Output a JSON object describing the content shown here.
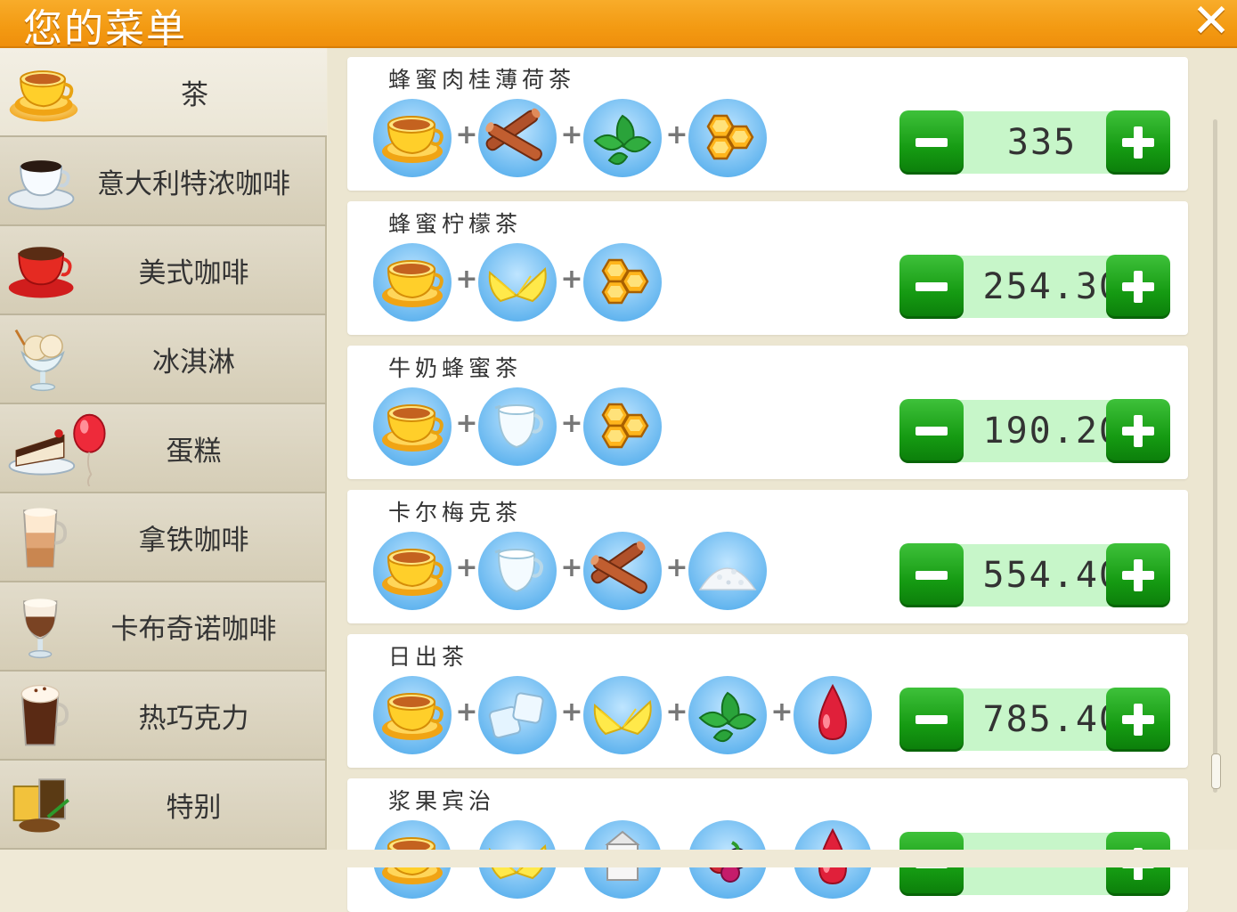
{
  "header": {
    "title": "您的菜单",
    "close_label": "✕"
  },
  "categories": [
    {
      "label": "茶",
      "icon": "tea-cup-icon",
      "active": true
    },
    {
      "label": "意大利特浓咖啡",
      "icon": "espresso-cup-icon"
    },
    {
      "label": "美式咖啡",
      "icon": "americano-cup-icon"
    },
    {
      "label": "冰淇淋",
      "icon": "ice-cream-icon"
    },
    {
      "label": "蛋糕",
      "icon": "cake-with-balloon-icon"
    },
    {
      "label": "拿铁咖啡",
      "icon": "latte-glass-icon"
    },
    {
      "label": "卡布奇诺咖啡",
      "icon": "cappuccino-glass-icon"
    },
    {
      "label": "热巧克力",
      "icon": "hot-chocolate-icon"
    },
    {
      "label": "特别",
      "icon": "special-drinks-icon"
    }
  ],
  "recipes": [
    {
      "name": "蜂蜜肉桂薄荷茶",
      "ingredients": [
        "tea",
        "cinnamon",
        "mint",
        "honey"
      ],
      "price": "335"
    },
    {
      "name": "蜂蜜柠檬茶",
      "ingredients": [
        "tea",
        "lemon",
        "honey"
      ],
      "price": "254.30"
    },
    {
      "name": "牛奶蜂蜜茶",
      "ingredients": [
        "tea",
        "milk",
        "honey"
      ],
      "price": "190.20"
    },
    {
      "name": "卡尔梅克茶",
      "ingredients": [
        "tea",
        "milk",
        "cinnamon",
        "salt"
      ],
      "price": "554.40"
    },
    {
      "name": "日出茶",
      "ingredients": [
        "tea",
        "ice",
        "lemon",
        "mint",
        "syrup"
      ],
      "price": "785.40"
    },
    {
      "name": "浆果宾治",
      "ingredients": [
        "tea",
        "lemon",
        "milk-carton",
        "berries",
        "syrup"
      ],
      "price": ""
    }
  ],
  "stepper": {
    "minus_label": "−",
    "plus_label": "+"
  },
  "colors": {
    "header_orange": "#f39a12",
    "stepper_green": "#159a12",
    "quantity_bg": "#c7f6c9",
    "ingredient_circle": "#7cc3f2"
  }
}
